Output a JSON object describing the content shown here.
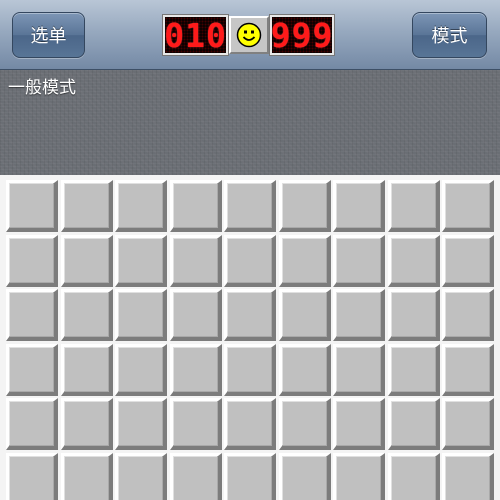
{
  "navbar": {
    "menu_button": "选单",
    "mode_button": "模式"
  },
  "counters": {
    "mines_remaining": "010",
    "timer": "999"
  },
  "face": {
    "state": "smile",
    "icon": "smiley-face-icon",
    "color": "#ffff00"
  },
  "mode_label": "一般模式",
  "board": {
    "visible_columns": 9,
    "visible_rows": 6,
    "cell_state": "unrevealed"
  },
  "colors": {
    "counter_digits": "#ff1a1a",
    "cell_face": "#c0c0c0",
    "navbar_top": "#b9c6d6",
    "navbar_bottom": "#7489a5"
  }
}
